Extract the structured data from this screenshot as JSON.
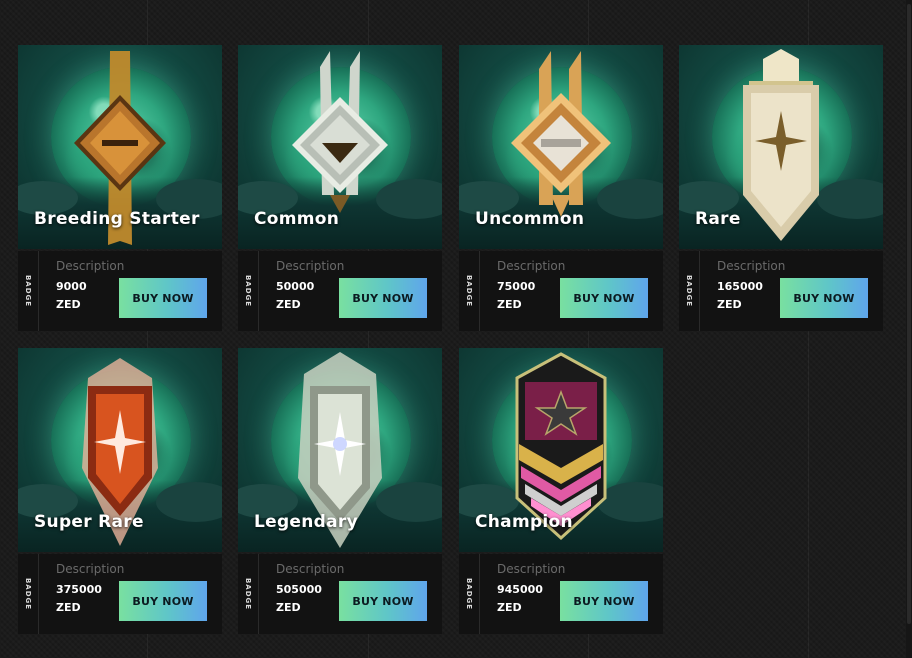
{
  "currency": "ZED",
  "colors": {
    "page_background": "#1b1b1b",
    "card_background": "#121212",
    "button_gradient": [
      "#79e0a0",
      "#5fc6c8",
      "#5fa5ec"
    ],
    "muted_text": "#6b6b6b"
  },
  "cards": [
    {
      "name": "Breeding Starter",
      "side_label": "BADGE",
      "description_label": "Description",
      "price": "9000",
      "currency": "ZED",
      "button_label": "BUY NOW",
      "badge_icon": "bronze-diamond-badge-icon"
    },
    {
      "name": "Common",
      "side_label": "BADGE",
      "description_label": "Description",
      "price": "50000",
      "currency": "ZED",
      "button_label": "BUY NOW",
      "badge_icon": "silver-diamond-badge-icon"
    },
    {
      "name": "Uncommon",
      "side_label": "BADGE",
      "description_label": "Description",
      "price": "75000",
      "currency": "ZED",
      "button_label": "BUY NOW",
      "badge_icon": "gold-diamond-badge-icon"
    },
    {
      "name": "Rare",
      "side_label": "BADGE",
      "description_label": "Description",
      "price": "165000",
      "currency": "ZED",
      "button_label": "BUY NOW",
      "badge_icon": "pearl-shield-star-badge-icon"
    },
    {
      "name": "Super Rare",
      "side_label": "BADGE",
      "description_label": "Description",
      "price": "375000",
      "currency": "ZED",
      "button_label": "BUY NOW",
      "badge_icon": "red-shield-star-badge-icon"
    },
    {
      "name": "Legendary",
      "side_label": "BADGE",
      "description_label": "Description",
      "price": "505000",
      "currency": "ZED",
      "button_label": "BUY NOW",
      "badge_icon": "silver-shield-star-badge-icon"
    },
    {
      "name": "Champion",
      "side_label": "BADGE",
      "description_label": "Description",
      "price": "945000",
      "currency": "ZED",
      "button_label": "BUY NOW",
      "badge_icon": "pink-chevron-star-badge-icon"
    }
  ]
}
